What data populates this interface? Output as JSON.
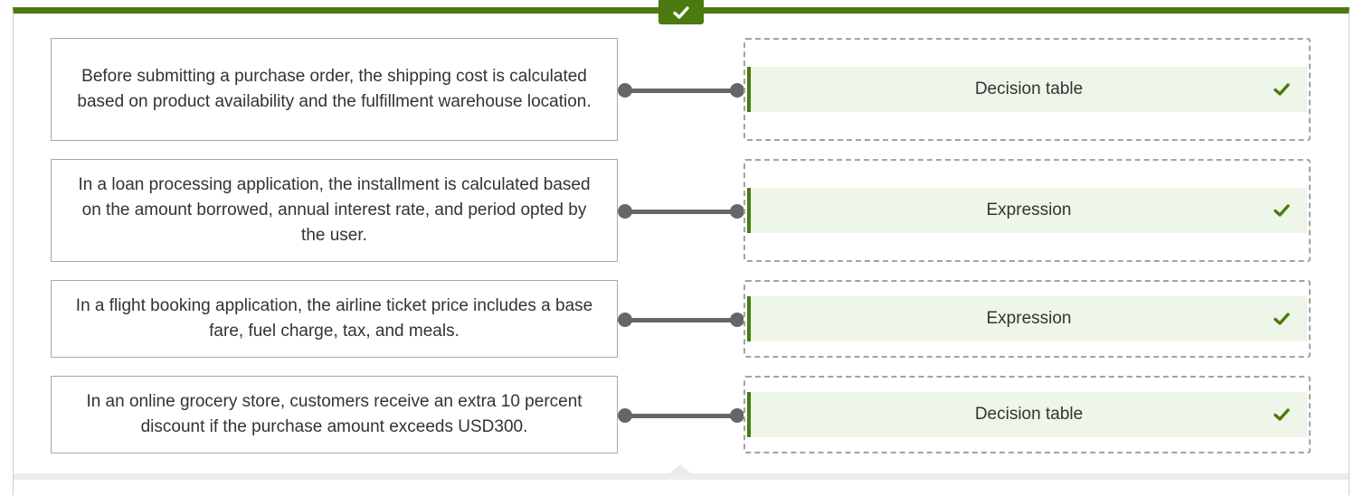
{
  "status": {
    "result_icon": "checkmark-icon",
    "accent_color": "#4a7a10",
    "correct_bg": "#eef6e9"
  },
  "pairs": [
    {
      "prompt": "Before submitting a purchase order, the shipping cost is calculated based on product availability and the fulfillment warehouse location.",
      "answer": "Decision table",
      "correct": true
    },
    {
      "prompt": "In a loan processing application, the installment is calculated based on the amount borrowed, annual interest rate, and period opted by the user.",
      "answer": "Expression",
      "correct": true
    },
    {
      "prompt": "In a flight booking application, the airline ticket price includes a base fare, fuel charge, tax, and meals.",
      "answer": "Expression",
      "correct": true
    },
    {
      "prompt": "In an online grocery store, customers receive an extra 10 percent discount if the purchase amount exceeds USD300.",
      "answer": "Decision table",
      "correct": true
    }
  ]
}
